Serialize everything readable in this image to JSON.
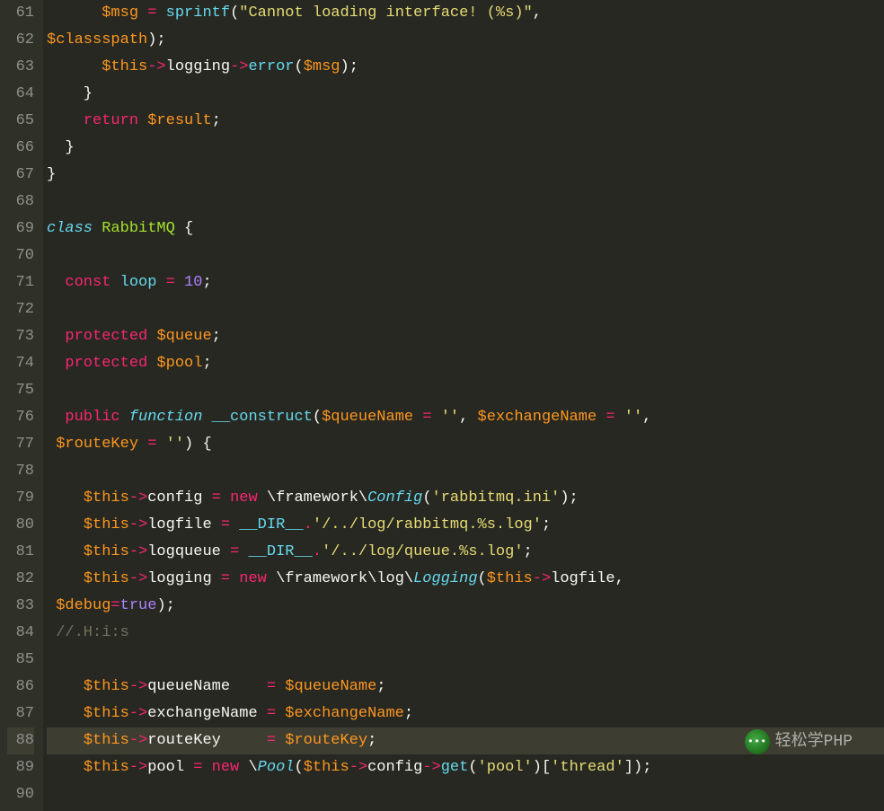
{
  "startLine": 61,
  "currentLine": 88,
  "watermark": {
    "text": "轻松学PHP",
    "iconGlyph": "•••"
  },
  "lines": [
    [
      {
        "t": "      ",
        "c": "plain"
      },
      {
        "t": "$msg",
        "c": "var"
      },
      {
        "t": " ",
        "c": "plain"
      },
      {
        "t": "=",
        "c": "op"
      },
      {
        "t": " ",
        "c": "plain"
      },
      {
        "t": "sprintf",
        "c": "fn"
      },
      {
        "t": "(",
        "c": "plain"
      },
      {
        "t": "\"Cannot loading interface! (%s)\"",
        "c": "str"
      },
      {
        "t": ",",
        "c": "plain"
      }
    ],
    [
      {
        "t": "$classspath",
        "c": "var"
      },
      {
        "t": ");",
        "c": "plain"
      }
    ],
    [
      {
        "t": "      ",
        "c": "plain"
      },
      {
        "t": "$this",
        "c": "var"
      },
      {
        "t": "->",
        "c": "op"
      },
      {
        "t": "logging",
        "c": "plain"
      },
      {
        "t": "->",
        "c": "op"
      },
      {
        "t": "error",
        "c": "fn"
      },
      {
        "t": "(",
        "c": "plain"
      },
      {
        "t": "$msg",
        "c": "var"
      },
      {
        "t": ");",
        "c": "plain"
      }
    ],
    [
      {
        "t": "    }",
        "c": "plain"
      }
    ],
    [
      {
        "t": "    ",
        "c": "plain"
      },
      {
        "t": "return",
        "c": "kw"
      },
      {
        "t": " ",
        "c": "plain"
      },
      {
        "t": "$result",
        "c": "var"
      },
      {
        "t": ";",
        "c": "plain"
      }
    ],
    [
      {
        "t": "  }",
        "c": "plain"
      }
    ],
    [
      {
        "t": "}",
        "c": "plain"
      }
    ],
    [],
    [
      {
        "t": "class",
        "c": "kw2"
      },
      {
        "t": " ",
        "c": "plain"
      },
      {
        "t": "RabbitMQ",
        "c": "name"
      },
      {
        "t": " {",
        "c": "plain"
      }
    ],
    [],
    [
      {
        "t": "  ",
        "c": "plain"
      },
      {
        "t": "const",
        "c": "modifier"
      },
      {
        "t": " ",
        "c": "plain"
      },
      {
        "t": "loop",
        "c": "fn"
      },
      {
        "t": " ",
        "c": "plain"
      },
      {
        "t": "=",
        "c": "op"
      },
      {
        "t": " ",
        "c": "plain"
      },
      {
        "t": "10",
        "c": "num"
      },
      {
        "t": ";",
        "c": "plain"
      }
    ],
    [],
    [
      {
        "t": "  ",
        "c": "plain"
      },
      {
        "t": "protected",
        "c": "modifier"
      },
      {
        "t": " ",
        "c": "plain"
      },
      {
        "t": "$queue",
        "c": "var"
      },
      {
        "t": ";",
        "c": "plain"
      }
    ],
    [
      {
        "t": "  ",
        "c": "plain"
      },
      {
        "t": "protected",
        "c": "modifier"
      },
      {
        "t": " ",
        "c": "plain"
      },
      {
        "t": "$pool",
        "c": "var"
      },
      {
        "t": ";",
        "c": "plain"
      }
    ],
    [],
    [
      {
        "t": "  ",
        "c": "plain"
      },
      {
        "t": "public",
        "c": "modifier"
      },
      {
        "t": " ",
        "c": "plain"
      },
      {
        "t": "function",
        "c": "kw2"
      },
      {
        "t": " ",
        "c": "plain"
      },
      {
        "t": "__construct",
        "c": "fn"
      },
      {
        "t": "(",
        "c": "plain"
      },
      {
        "t": "$queueName",
        "c": "var"
      },
      {
        "t": " ",
        "c": "plain"
      },
      {
        "t": "=",
        "c": "op"
      },
      {
        "t": " ",
        "c": "plain"
      },
      {
        "t": "''",
        "c": "str"
      },
      {
        "t": ", ",
        "c": "plain"
      },
      {
        "t": "$exchangeName",
        "c": "var"
      },
      {
        "t": " ",
        "c": "plain"
      },
      {
        "t": "=",
        "c": "op"
      },
      {
        "t": " ",
        "c": "plain"
      },
      {
        "t": "''",
        "c": "str"
      },
      {
        "t": ",",
        "c": "plain"
      }
    ],
    [
      {
        "t": " ",
        "c": "plain"
      },
      {
        "t": "$routeKey",
        "c": "var"
      },
      {
        "t": " ",
        "c": "plain"
      },
      {
        "t": "=",
        "c": "op"
      },
      {
        "t": " ",
        "c": "plain"
      },
      {
        "t": "''",
        "c": "str"
      },
      {
        "t": ") {",
        "c": "plain"
      }
    ],
    [],
    [
      {
        "t": "    ",
        "c": "plain"
      },
      {
        "t": "$this",
        "c": "var"
      },
      {
        "t": "->",
        "c": "op"
      },
      {
        "t": "config ",
        "c": "plain"
      },
      {
        "t": "=",
        "c": "op"
      },
      {
        "t": " ",
        "c": "plain"
      },
      {
        "t": "new",
        "c": "op"
      },
      {
        "t": " \\framework\\",
        "c": "plain"
      },
      {
        "t": "Config",
        "c": "kw2"
      },
      {
        "t": "(",
        "c": "plain"
      },
      {
        "t": "'rabbitmq.ini'",
        "c": "str"
      },
      {
        "t": ");",
        "c": "plain"
      }
    ],
    [
      {
        "t": "    ",
        "c": "plain"
      },
      {
        "t": "$this",
        "c": "var"
      },
      {
        "t": "->",
        "c": "op"
      },
      {
        "t": "logfile ",
        "c": "plain"
      },
      {
        "t": "=",
        "c": "op"
      },
      {
        "t": " ",
        "c": "plain"
      },
      {
        "t": "__DIR__",
        "c": "fn"
      },
      {
        "t": ".",
        "c": "op"
      },
      {
        "t": "'/../log/rabbitmq.%s.log'",
        "c": "str"
      },
      {
        "t": ";",
        "c": "plain"
      }
    ],
    [
      {
        "t": "    ",
        "c": "plain"
      },
      {
        "t": "$this",
        "c": "var"
      },
      {
        "t": "->",
        "c": "op"
      },
      {
        "t": "logqueue ",
        "c": "plain"
      },
      {
        "t": "=",
        "c": "op"
      },
      {
        "t": " ",
        "c": "plain"
      },
      {
        "t": "__DIR__",
        "c": "fn"
      },
      {
        "t": ".",
        "c": "op"
      },
      {
        "t": "'/../log/queue.%s.log'",
        "c": "str"
      },
      {
        "t": ";",
        "c": "plain"
      }
    ],
    [
      {
        "t": "    ",
        "c": "plain"
      },
      {
        "t": "$this",
        "c": "var"
      },
      {
        "t": "->",
        "c": "op"
      },
      {
        "t": "logging ",
        "c": "plain"
      },
      {
        "t": "=",
        "c": "op"
      },
      {
        "t": " ",
        "c": "plain"
      },
      {
        "t": "new",
        "c": "op"
      },
      {
        "t": " \\framework\\log\\",
        "c": "plain"
      },
      {
        "t": "Logging",
        "c": "kw2"
      },
      {
        "t": "(",
        "c": "plain"
      },
      {
        "t": "$this",
        "c": "var"
      },
      {
        "t": "->",
        "c": "op"
      },
      {
        "t": "logfile,",
        "c": "plain"
      }
    ],
    [
      {
        "t": " ",
        "c": "plain"
      },
      {
        "t": "$debug",
        "c": "var"
      },
      {
        "t": "=",
        "c": "op"
      },
      {
        "t": "true",
        "c": "const"
      },
      {
        "t": ");",
        "c": "plain"
      }
    ],
    [
      {
        "t": " ",
        "c": "plain"
      },
      {
        "t": "//.H:i:s",
        "c": "comment"
      }
    ],
    [],
    [
      {
        "t": "    ",
        "c": "plain"
      },
      {
        "t": "$this",
        "c": "var"
      },
      {
        "t": "->",
        "c": "op"
      },
      {
        "t": "queueName    ",
        "c": "plain"
      },
      {
        "t": "=",
        "c": "op"
      },
      {
        "t": " ",
        "c": "plain"
      },
      {
        "t": "$queueName",
        "c": "var"
      },
      {
        "t": ";",
        "c": "plain"
      }
    ],
    [
      {
        "t": "    ",
        "c": "plain"
      },
      {
        "t": "$this",
        "c": "var"
      },
      {
        "t": "->",
        "c": "op"
      },
      {
        "t": "exchangeName ",
        "c": "plain"
      },
      {
        "t": "=",
        "c": "op"
      },
      {
        "t": " ",
        "c": "plain"
      },
      {
        "t": "$exchangeName",
        "c": "var"
      },
      {
        "t": ";",
        "c": "plain"
      }
    ],
    [
      {
        "t": "    ",
        "c": "plain"
      },
      {
        "t": "$this",
        "c": "var"
      },
      {
        "t": "->",
        "c": "op"
      },
      {
        "t": "routeKey     ",
        "c": "plain"
      },
      {
        "t": "=",
        "c": "op"
      },
      {
        "t": " ",
        "c": "plain"
      },
      {
        "t": "$routeKey",
        "c": "var"
      },
      {
        "t": ";",
        "c": "plain"
      }
    ],
    [
      {
        "t": "    ",
        "c": "plain"
      },
      {
        "t": "$this",
        "c": "var"
      },
      {
        "t": "->",
        "c": "op"
      },
      {
        "t": "pool ",
        "c": "plain"
      },
      {
        "t": "=",
        "c": "op"
      },
      {
        "t": " ",
        "c": "plain"
      },
      {
        "t": "new",
        "c": "op"
      },
      {
        "t": " \\",
        "c": "plain"
      },
      {
        "t": "Pool",
        "c": "kw2"
      },
      {
        "t": "(",
        "c": "plain"
      },
      {
        "t": "$this",
        "c": "var"
      },
      {
        "t": "->",
        "c": "op"
      },
      {
        "t": "config",
        "c": "plain"
      },
      {
        "t": "->",
        "c": "op"
      },
      {
        "t": "get",
        "c": "fn"
      },
      {
        "t": "(",
        "c": "plain"
      },
      {
        "t": "'pool'",
        "c": "str"
      },
      {
        "t": ")[",
        "c": "plain"
      },
      {
        "t": "'thread'",
        "c": "str"
      },
      {
        "t": "]);",
        "c": "plain"
      }
    ],
    []
  ]
}
